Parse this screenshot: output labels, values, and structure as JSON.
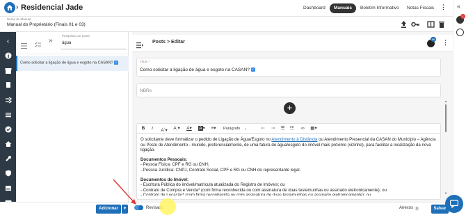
{
  "header": {
    "title": "Residencial Jade",
    "nav": [
      "Dashboard",
      "Manuais",
      "Boletim Informativo",
      "Notas Fiscais"
    ],
    "active_nav": "Manuais"
  },
  "manual": {
    "label": "Nome do Manual",
    "value": "Manual do Proprietário (Finais 01 e 03)"
  },
  "left_panel": {
    "search_label": "Pesquisar por posts",
    "search_value": "água",
    "items": [
      {
        "label": "Como solicitar a ligação de água e esgoto na CASAN?"
      }
    ]
  },
  "editor": {
    "breadcrumb": "Posts > Editar",
    "notification_count": "99",
    "title_label": "Título *",
    "title_value": "Como solicitar a ligação de água e esgoto na CASAN?",
    "nbrs_label": "NBRs",
    "paragraph_select": "Parágrafo",
    "body": {
      "p1_pre": "O solicitante deve formalizar o pedido de Ligação de Água/Esgoto no ",
      "p1_link": "Atendimento à Distância",
      "p1_post": " ou Atendimento Presencial da CASAN do Município – Agência ou Posto de Atendimento - munido, preferencialmente, de uma fatura de água/esgoto do imóvel mais próximo (vizinho), para facilitar a localização da nova ligação.",
      "h2": "Documentos Pessoais:",
      "l2a": "- Pessoa Física: CPF e RG ou CNH;",
      "l2b": "- Pessoa Jurídica: CNPJ, Contrato Social, CPF e RG ou CNH do representante legal.",
      "h3": "Documentos do Imóvel:",
      "l3a": "- Escritura Pública do imóvel/matrícula atualizada do Registro de Imóveis; ou",
      "l3b": "- Contrato de Compra e Venda* (com firma reconhecida ou com assinatura de duas testemunhas ou assinado eletronicamente); ou",
      "l3c": "- Contrato de Locação* (com firma reconhecida ou com assinatura de duas testemunhas ou assinado eletronicamente); ou"
    }
  },
  "bottom": {
    "add_label": "Adicionar",
    "review_label": "Revisado",
    "annexes_label": "Anexos",
    "annexes_count": "0",
    "save_label": "Salvar"
  },
  "colors": {
    "brand": "#1e6fb8",
    "sidebar": "#2d3a46"
  }
}
